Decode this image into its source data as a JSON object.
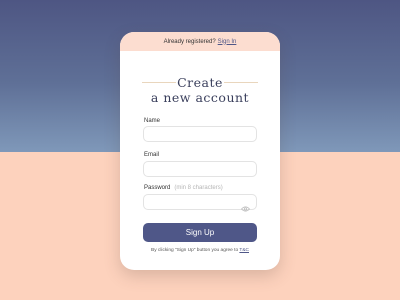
{
  "header": {
    "prompt": "Already registered?",
    "signin_link": "Sign In"
  },
  "form": {
    "title_line1": "Create",
    "title_line2": "a new account",
    "name_label": "Name",
    "email_label": "Email",
    "password_label": "Password",
    "password_hint": "(min 8 characters)",
    "submit_label": "Sign Up",
    "terms_text": "By clicking \"Sign Up\" button you agree to",
    "terms_link": "T&C"
  },
  "icons": {
    "password_toggle": "eye-icon"
  },
  "colors": {
    "accent": "#4f5788",
    "background_top": "#4e5683",
    "background_bottom": "#fdd2bd",
    "card_header": "#fcddd0"
  }
}
